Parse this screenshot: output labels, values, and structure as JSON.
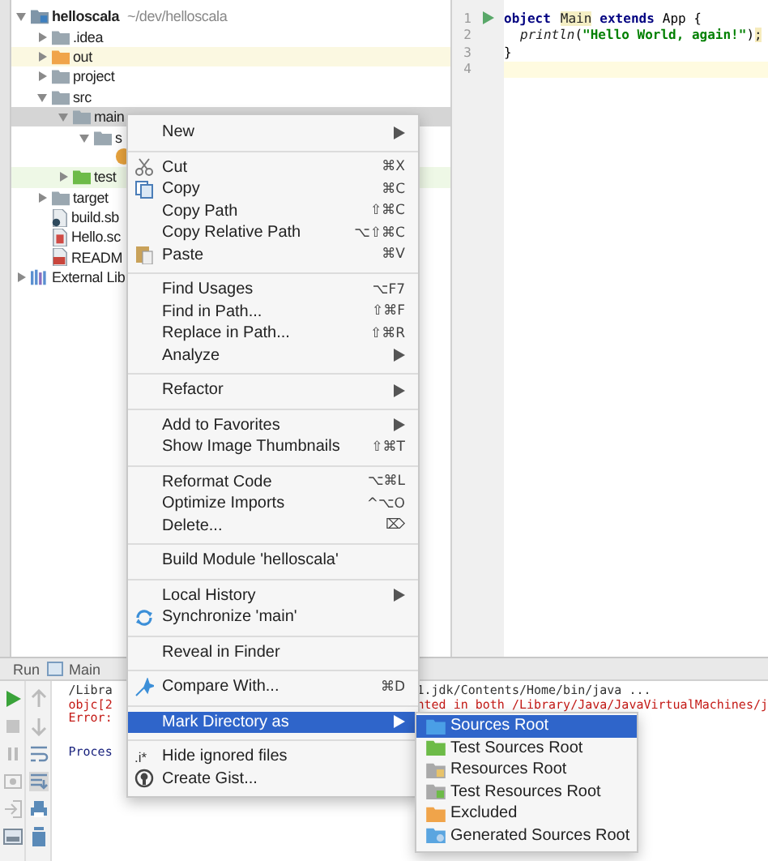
{
  "tree": [
    {
      "name": "helloscala",
      "path": "~/dev/helloscala",
      "kind": "module",
      "expanded": true,
      "selected": false,
      "children": [
        {
          "name": ".idea",
          "kind": "folder",
          "expanded": false,
          "selected": false
        },
        {
          "name": "out",
          "kind": "excluded",
          "expanded": false,
          "selected": false
        },
        {
          "name": "project",
          "kind": "folder",
          "expanded": false,
          "selected": false
        },
        {
          "name": "src",
          "kind": "folder",
          "expanded": true,
          "selected": false,
          "children": [
            {
              "name": "main",
              "kind": "folder",
              "expanded": true,
              "selected": true,
              "children": [
                {
                  "name": "s",
                  "kind": "folder",
                  "expanded": true,
                  "selected": false,
                  "children": [
                    {
                      "kind": "object",
                      "selected": false
                    }
                  ]
                }
              ]
            },
            {
              "name": "test",
              "kind": "test",
              "expanded": false,
              "selected": false
            }
          ]
        },
        {
          "name": "target",
          "kind": "folder",
          "expanded": false,
          "selected": false
        },
        {
          "name": "build.sb",
          "kind": "sbt",
          "selected": false
        },
        {
          "name": "Hello.sc",
          "kind": "scala",
          "selected": false
        },
        {
          "name": "READM",
          "kind": "markdown",
          "selected": false
        }
      ]
    },
    {
      "name": "External Lib",
      "kind": "library",
      "expanded": false,
      "selected": false
    }
  ],
  "editor": {
    "lines": [
      {
        "number": "1",
        "runnable": true,
        "current": false,
        "tokens": [
          {
            "text": "object",
            "kind": "keyword"
          },
          {
            "text": "Main",
            "kind": "usage",
            "space_before": true
          },
          {
            "text": "extends",
            "kind": "keyword",
            "space_before": true
          },
          {
            "text": "App {",
            "kind": "plain",
            "space_before": true
          }
        ]
      },
      {
        "number": "2",
        "runnable": false,
        "current": false,
        "indent": true,
        "tokens": [
          {
            "text": "println",
            "kind": "method"
          },
          {
            "text": "(",
            "kind": "plain"
          },
          {
            "text": "\"Hello World, again!\"",
            "kind": "string"
          },
          {
            "text": ")",
            "kind": "plain"
          },
          {
            "text": ";",
            "kind": "warning"
          }
        ]
      },
      {
        "number": "3",
        "runnable": false,
        "current": false,
        "tokens": [
          {
            "text": "}",
            "kind": "plain"
          }
        ]
      },
      {
        "number": "4",
        "runnable": false,
        "current": true
      }
    ]
  },
  "run": {
    "label": "Run",
    "tab": "Main",
    "console": [
      {
        "kind": "command",
        "left": "/Libra",
        "right": "1.jdk/Contents/Home/bin/java ..."
      },
      {
        "kind": "error",
        "left": "objc[2",
        "right": "nted in both /Library/Java/JavaVirtualMachines/j"
      },
      {
        "kind": "error",
        "left": "Error:"
      },
      {
        "kind": "info",
        "left": "Proces",
        "gap_before": true
      }
    ]
  },
  "menu": {
    "sections": [
      {
        "items": [
          {
            "label": "New",
            "submenu": true,
            "selected": false
          }
        ]
      },
      {
        "items": [
          {
            "label": "Cut",
            "kind": "cut",
            "shortcut": "⌘X",
            "selected": false
          },
          {
            "label": "Copy",
            "kind": "copy",
            "shortcut": "⌘C",
            "selected": false
          },
          {
            "label": "Copy Path",
            "shortcut": "⇧⌘C",
            "selected": false
          },
          {
            "label": "Copy Relative Path",
            "shortcut": "⌥⇧⌘C",
            "selected": false
          },
          {
            "label": "Paste",
            "kind": "paste",
            "shortcut": "⌘V",
            "selected": false
          }
        ]
      },
      {
        "items": [
          {
            "label": "Find Usages",
            "shortcut": "⌥F7",
            "selected": false
          },
          {
            "label": "Find in Path...",
            "shortcut": "⇧⌘F",
            "selected": false
          },
          {
            "label": "Replace in Path...",
            "shortcut": "⇧⌘R",
            "selected": false
          },
          {
            "label": "Analyze",
            "submenu": true,
            "selected": false
          }
        ]
      },
      {
        "items": [
          {
            "label": "Refactor",
            "submenu": true,
            "selected": false
          }
        ]
      },
      {
        "items": [
          {
            "label": "Add to Favorites",
            "submenu": true,
            "selected": false
          },
          {
            "label": "Show Image Thumbnails",
            "shortcut": "⇧⌘T",
            "selected": false
          }
        ]
      },
      {
        "items": [
          {
            "label": "Reformat Code",
            "shortcut": "⌥⌘L",
            "selected": false
          },
          {
            "label": "Optimize Imports",
            "shortcut": "^⌥O",
            "selected": false
          },
          {
            "label": "Delete...",
            "shortcut": "⌦",
            "selected": false
          }
        ]
      },
      {
        "items": [
          {
            "label": "Build Module 'helloscala'",
            "selected": false
          }
        ]
      },
      {
        "items": [
          {
            "label": "Local History",
            "submenu": true,
            "selected": false
          },
          {
            "label": "Synchronize 'main'",
            "kind": "sync",
            "selected": false
          }
        ]
      },
      {
        "items": [
          {
            "label": "Reveal in Finder",
            "selected": false
          }
        ]
      },
      {
        "items": [
          {
            "label": "Compare With...",
            "kind": "compare",
            "shortcut": "⌘D",
            "selected": false
          }
        ]
      },
      {
        "items": [
          {
            "label": "Mark Directory as",
            "submenu": true,
            "selected": true
          }
        ]
      },
      {
        "items": [
          {
            "label": "Hide ignored files",
            "icon_text": ".i*",
            "selected": false
          },
          {
            "label": "Create Gist...",
            "kind": "gist",
            "selected": false
          }
        ]
      }
    ]
  },
  "submenu": {
    "items": [
      {
        "label": "Sources Root",
        "kind": "sources",
        "selected": true
      },
      {
        "label": "Test Sources Root",
        "kind": "test",
        "selected": false
      },
      {
        "label": "Resources Root",
        "kind": "resources",
        "selected": false
      },
      {
        "label": "Test Resources Root",
        "kind": "test-resources",
        "selected": false
      },
      {
        "label": "Excluded",
        "kind": "excluded",
        "selected": false
      },
      {
        "label": "Generated Sources Root",
        "kind": "generated",
        "selected": false
      }
    ]
  }
}
